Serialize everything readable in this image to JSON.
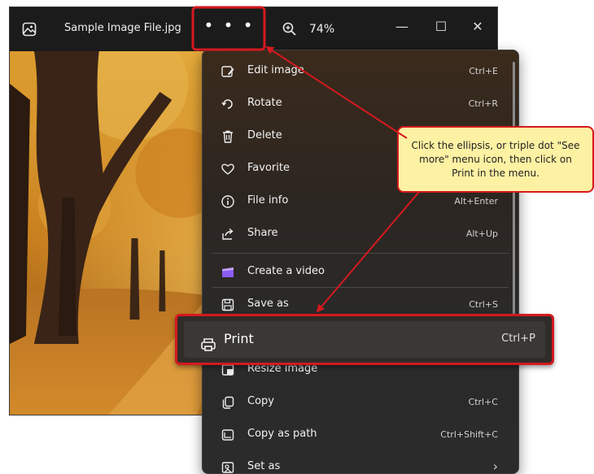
{
  "window": {
    "title": "Sample Image File.jpg",
    "more_label": "• • •",
    "zoom": "74%",
    "controls": {
      "minimize": "—",
      "maximize": "☐",
      "close": "✕"
    }
  },
  "menu": {
    "items": [
      {
        "label": "Edit image",
        "shortcut": "Ctrl+E",
        "icon": "edit-image-icon"
      },
      {
        "label": "Rotate",
        "shortcut": "Ctrl+R",
        "icon": "rotate-icon"
      },
      {
        "label": "Delete",
        "shortcut": "",
        "icon": "delete-icon"
      },
      {
        "label": "Favorite",
        "shortcut": "",
        "icon": "heart-icon"
      },
      {
        "label": "File info",
        "shortcut": "Alt+Enter",
        "icon": "info-icon"
      },
      {
        "label": "Share",
        "shortcut": "Alt+Up",
        "icon": "share-icon"
      },
      {
        "label": "Create a video",
        "shortcut": "",
        "icon": "clipchamp-icon"
      },
      {
        "label": "Save as",
        "shortcut": "Ctrl+S",
        "icon": "save-icon"
      },
      {
        "label": "Resize image",
        "shortcut": "",
        "icon": "resize-icon"
      },
      {
        "label": "Copy",
        "shortcut": "Ctrl+C",
        "icon": "copy-icon"
      },
      {
        "label": "Copy as path",
        "shortcut": "Ctrl+Shift+C",
        "icon": "copy-path-icon"
      },
      {
        "label": "Set as",
        "shortcut": "›",
        "icon": "set-as-icon"
      }
    ],
    "print": {
      "label": "Print",
      "shortcut": "Ctrl+P",
      "icon": "printer-icon"
    }
  },
  "callout": {
    "text": "Click the ellipsis, or triple dot \"See more\" menu icon, then click on Print in the menu."
  },
  "colors": {
    "highlight": "#d4191f",
    "callout_fill": "#fdf1a3",
    "menu_bg": "#2b2b2b",
    "titlebar_bg": "#1b1b1b"
  }
}
